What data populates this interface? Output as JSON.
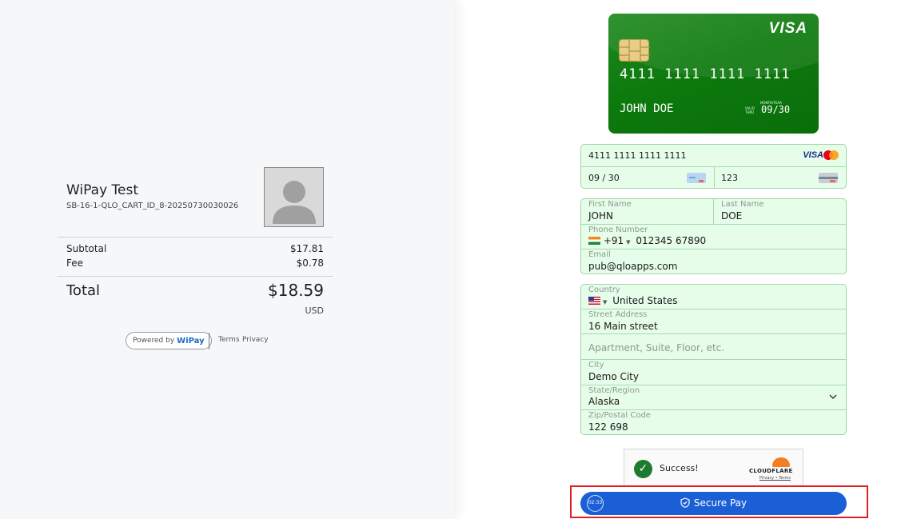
{
  "merchant": {
    "name": "WiPay Test",
    "order_id": "SB-16-1-QLO_CART_ID_8-20250730030026"
  },
  "summary": {
    "subtotal_label": "Subtotal",
    "subtotal_value": "$17.81",
    "fee_label": "Fee",
    "fee_value": "$0.78",
    "total_label": "Total",
    "total_value": "$18.59",
    "currency": "USD"
  },
  "footer": {
    "powered_prefix": "Powered by",
    "powered_brand": "WiPay",
    "terms": "Terms",
    "privacy": "Privacy"
  },
  "card_preview": {
    "brand": "VISA",
    "number": "4111 1111 1111 1111",
    "holder": "JOHN DOE",
    "valid_thru": "VALID THRU",
    "month_year": "MONTH/YEAR",
    "expiry": "09/30",
    "background_color": "#0d7a0d"
  },
  "payment_fields": {
    "card_number": "4111 1111 1111 1111",
    "visa_logo": "VISA",
    "expiry": "09 / 30",
    "cvv": "123"
  },
  "contact": {
    "first_name_label": "First Name",
    "first_name": "JOHN",
    "last_name_label": "Last Name",
    "last_name": "DOE",
    "phone_label": "Phone Number",
    "phone_code": "+91",
    "phone": "012345 67890",
    "email_label": "Email",
    "email": "pub@qloapps.com"
  },
  "address": {
    "country_label": "Country",
    "country": "United States",
    "street_label": "Street Address",
    "street": "16 Main street",
    "apartment_placeholder": "Apartment, Suite, Floor, etc.",
    "city_label": "City",
    "city": "Demo City",
    "state_label": "State/Region",
    "state": "Alaska",
    "zip_label": "Zip/Postal Code",
    "zip": "122 698"
  },
  "captcha": {
    "status": "Success!",
    "brand": "CLOUDFLARE",
    "links": "Privacy • Terms"
  },
  "pay": {
    "timer": "02:33",
    "label": "Secure Pay",
    "color": "#1b5fd6"
  },
  "colors": {
    "field_background": "#e6fde9",
    "field_border": "#9ed6a8",
    "highlight": "#e02020"
  }
}
